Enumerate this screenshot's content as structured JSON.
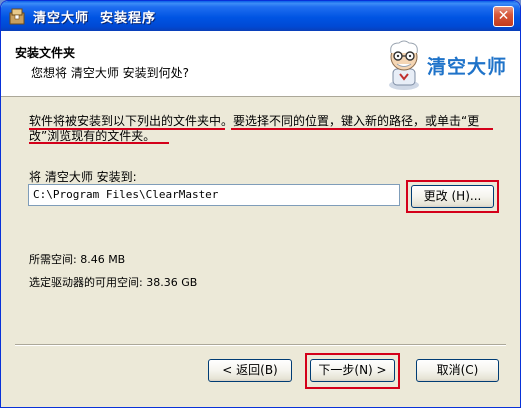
{
  "window": {
    "title": "清空大师  安装程序",
    "close_glyph": "✕"
  },
  "header": {
    "title": "安装文件夹",
    "subtitle": "您想将 清空大师 安装到何处?",
    "logo_text": "清空大师"
  },
  "description": {
    "line1_part1": "软件将被安装到以下列出的文件夹中。",
    "line1_part2": "要选择不同的位置，键入新的路径，或单击“更",
    "line2": "改”浏览现有的文件夹。"
  },
  "install_path": {
    "label": "将 清空大师 安装到:",
    "value": "C:\\Program Files\\ClearMaster"
  },
  "buttons": {
    "browse": "更改 (H)...",
    "back": "< 返回(B)",
    "next": "下一步(N) >",
    "cancel": "取消(C)"
  },
  "space": {
    "required": "所需空间: 8.46 MB",
    "available": "选定驱动器的可用空间: 38.36 GB"
  },
  "colors": {
    "title_bar": "#0054e3",
    "highlight_red": "#d4001a",
    "logo_blue": "#1f73c9",
    "window_bg": "#ece9d8"
  }
}
